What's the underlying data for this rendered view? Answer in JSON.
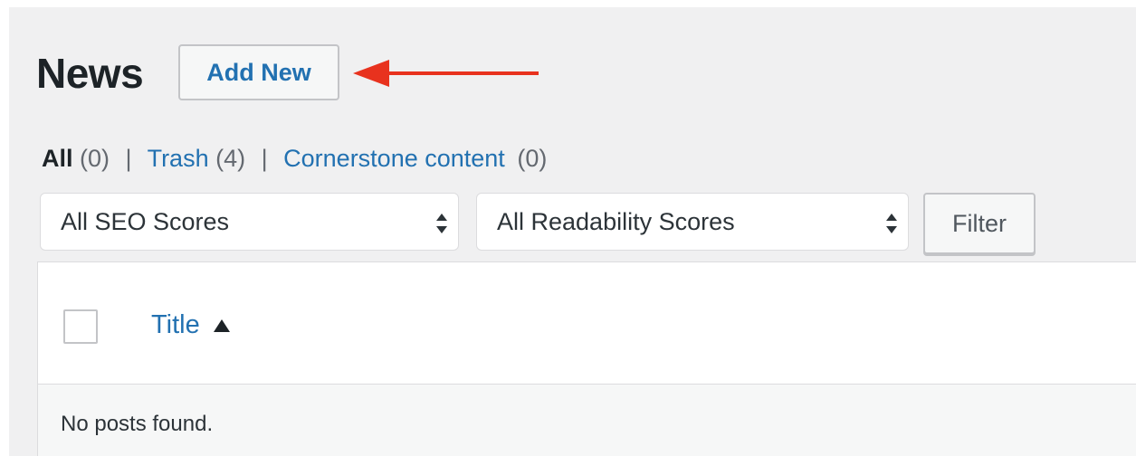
{
  "header": {
    "title": "News",
    "add_new_label": "Add New"
  },
  "views": {
    "all": {
      "label": "All",
      "count": "(0)"
    },
    "trash": {
      "label": "Trash",
      "count": "(4)"
    },
    "cornerstone": {
      "label": "Cornerstone content",
      "count": "(0)"
    },
    "separator": "|"
  },
  "filters": {
    "seo_select": "All SEO Scores",
    "readability_select": "All Readability Scores",
    "filter_button": "Filter"
  },
  "table": {
    "column_title": "Title",
    "empty_message": "No posts found."
  },
  "colors": {
    "annotation_arrow": "#e8321e",
    "link": "#2271b1"
  },
  "icons": {
    "sort": "sort-ascending-icon",
    "select_chevrons": "select-chevrons-icon",
    "annotation": "annotation-arrow-icon"
  }
}
